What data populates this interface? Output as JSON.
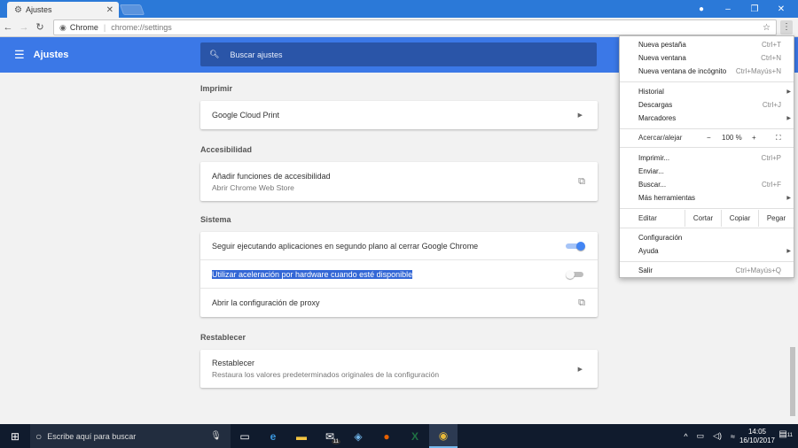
{
  "browser": {
    "tab_title": "Ajustes",
    "site_chip": "Chrome",
    "url": "chrome://settings",
    "accent": "#2b79d8"
  },
  "settings": {
    "title": "Ajustes",
    "search_placeholder": "Buscar ajustes",
    "header_color": "#3b78e7",
    "sections": {
      "print": {
        "title": "Imprimir",
        "row": {
          "label": "Google Cloud Print"
        }
      },
      "accessibility": {
        "title": "Accesibilidad",
        "row": {
          "label": "Añadir funciones de accesibilidad",
          "sub": "Abrir Chrome Web Store"
        }
      },
      "system": {
        "title": "Sistema",
        "rows": [
          {
            "label": "Seguir ejecutando aplicaciones en segundo plano al cerrar Google Chrome",
            "enabled": true
          },
          {
            "label": "Utilizar aceleración por hardware cuando esté disponible",
            "enabled": false
          },
          {
            "label": "Abrir la configuración de proxy"
          }
        ]
      },
      "reset": {
        "title": "Restablecer",
        "row": {
          "label": "Restablecer",
          "sub": "Restaura los valores predeterminados originales de la configuración"
        }
      }
    }
  },
  "menu": {
    "items": [
      {
        "label": "Nueva pestaña",
        "shortcut": "Ctrl+T"
      },
      {
        "label": "Nueva ventana",
        "shortcut": "Ctrl+N"
      },
      {
        "label": "Nueva ventana de incógnito",
        "shortcut": "Ctrl+Mayús+N"
      },
      {
        "label": "Historial",
        "shortcut": ""
      },
      {
        "label": "Descargas",
        "shortcut": "Ctrl+J"
      },
      {
        "label": "Marcadores",
        "shortcut": ""
      },
      {
        "label": "Imprimir...",
        "shortcut": "Ctrl+P"
      },
      {
        "label": "Enviar...",
        "shortcut": ""
      },
      {
        "label": "Buscar...",
        "shortcut": "Ctrl+F"
      },
      {
        "label": "Más herramientas",
        "shortcut": ""
      },
      {
        "label": "Configuración",
        "shortcut": ""
      },
      {
        "label": "Ayuda",
        "shortcut": ""
      },
      {
        "label": "Salir",
        "shortcut": "Ctrl+Mayús+Q"
      }
    ],
    "zoom": {
      "label": "Acercar/alejar",
      "minus": "−",
      "value": "100 %",
      "plus": "+"
    },
    "edit": {
      "label": "Editar",
      "cut": "Cortar",
      "copy": "Copiar",
      "paste": "Pegar"
    }
  },
  "taskbar": {
    "search_placeholder": "Escribe aquí para buscar",
    "time": "14:05",
    "date": "16/10/2017",
    "mail_badge": "11",
    "notif_badge": "11"
  }
}
